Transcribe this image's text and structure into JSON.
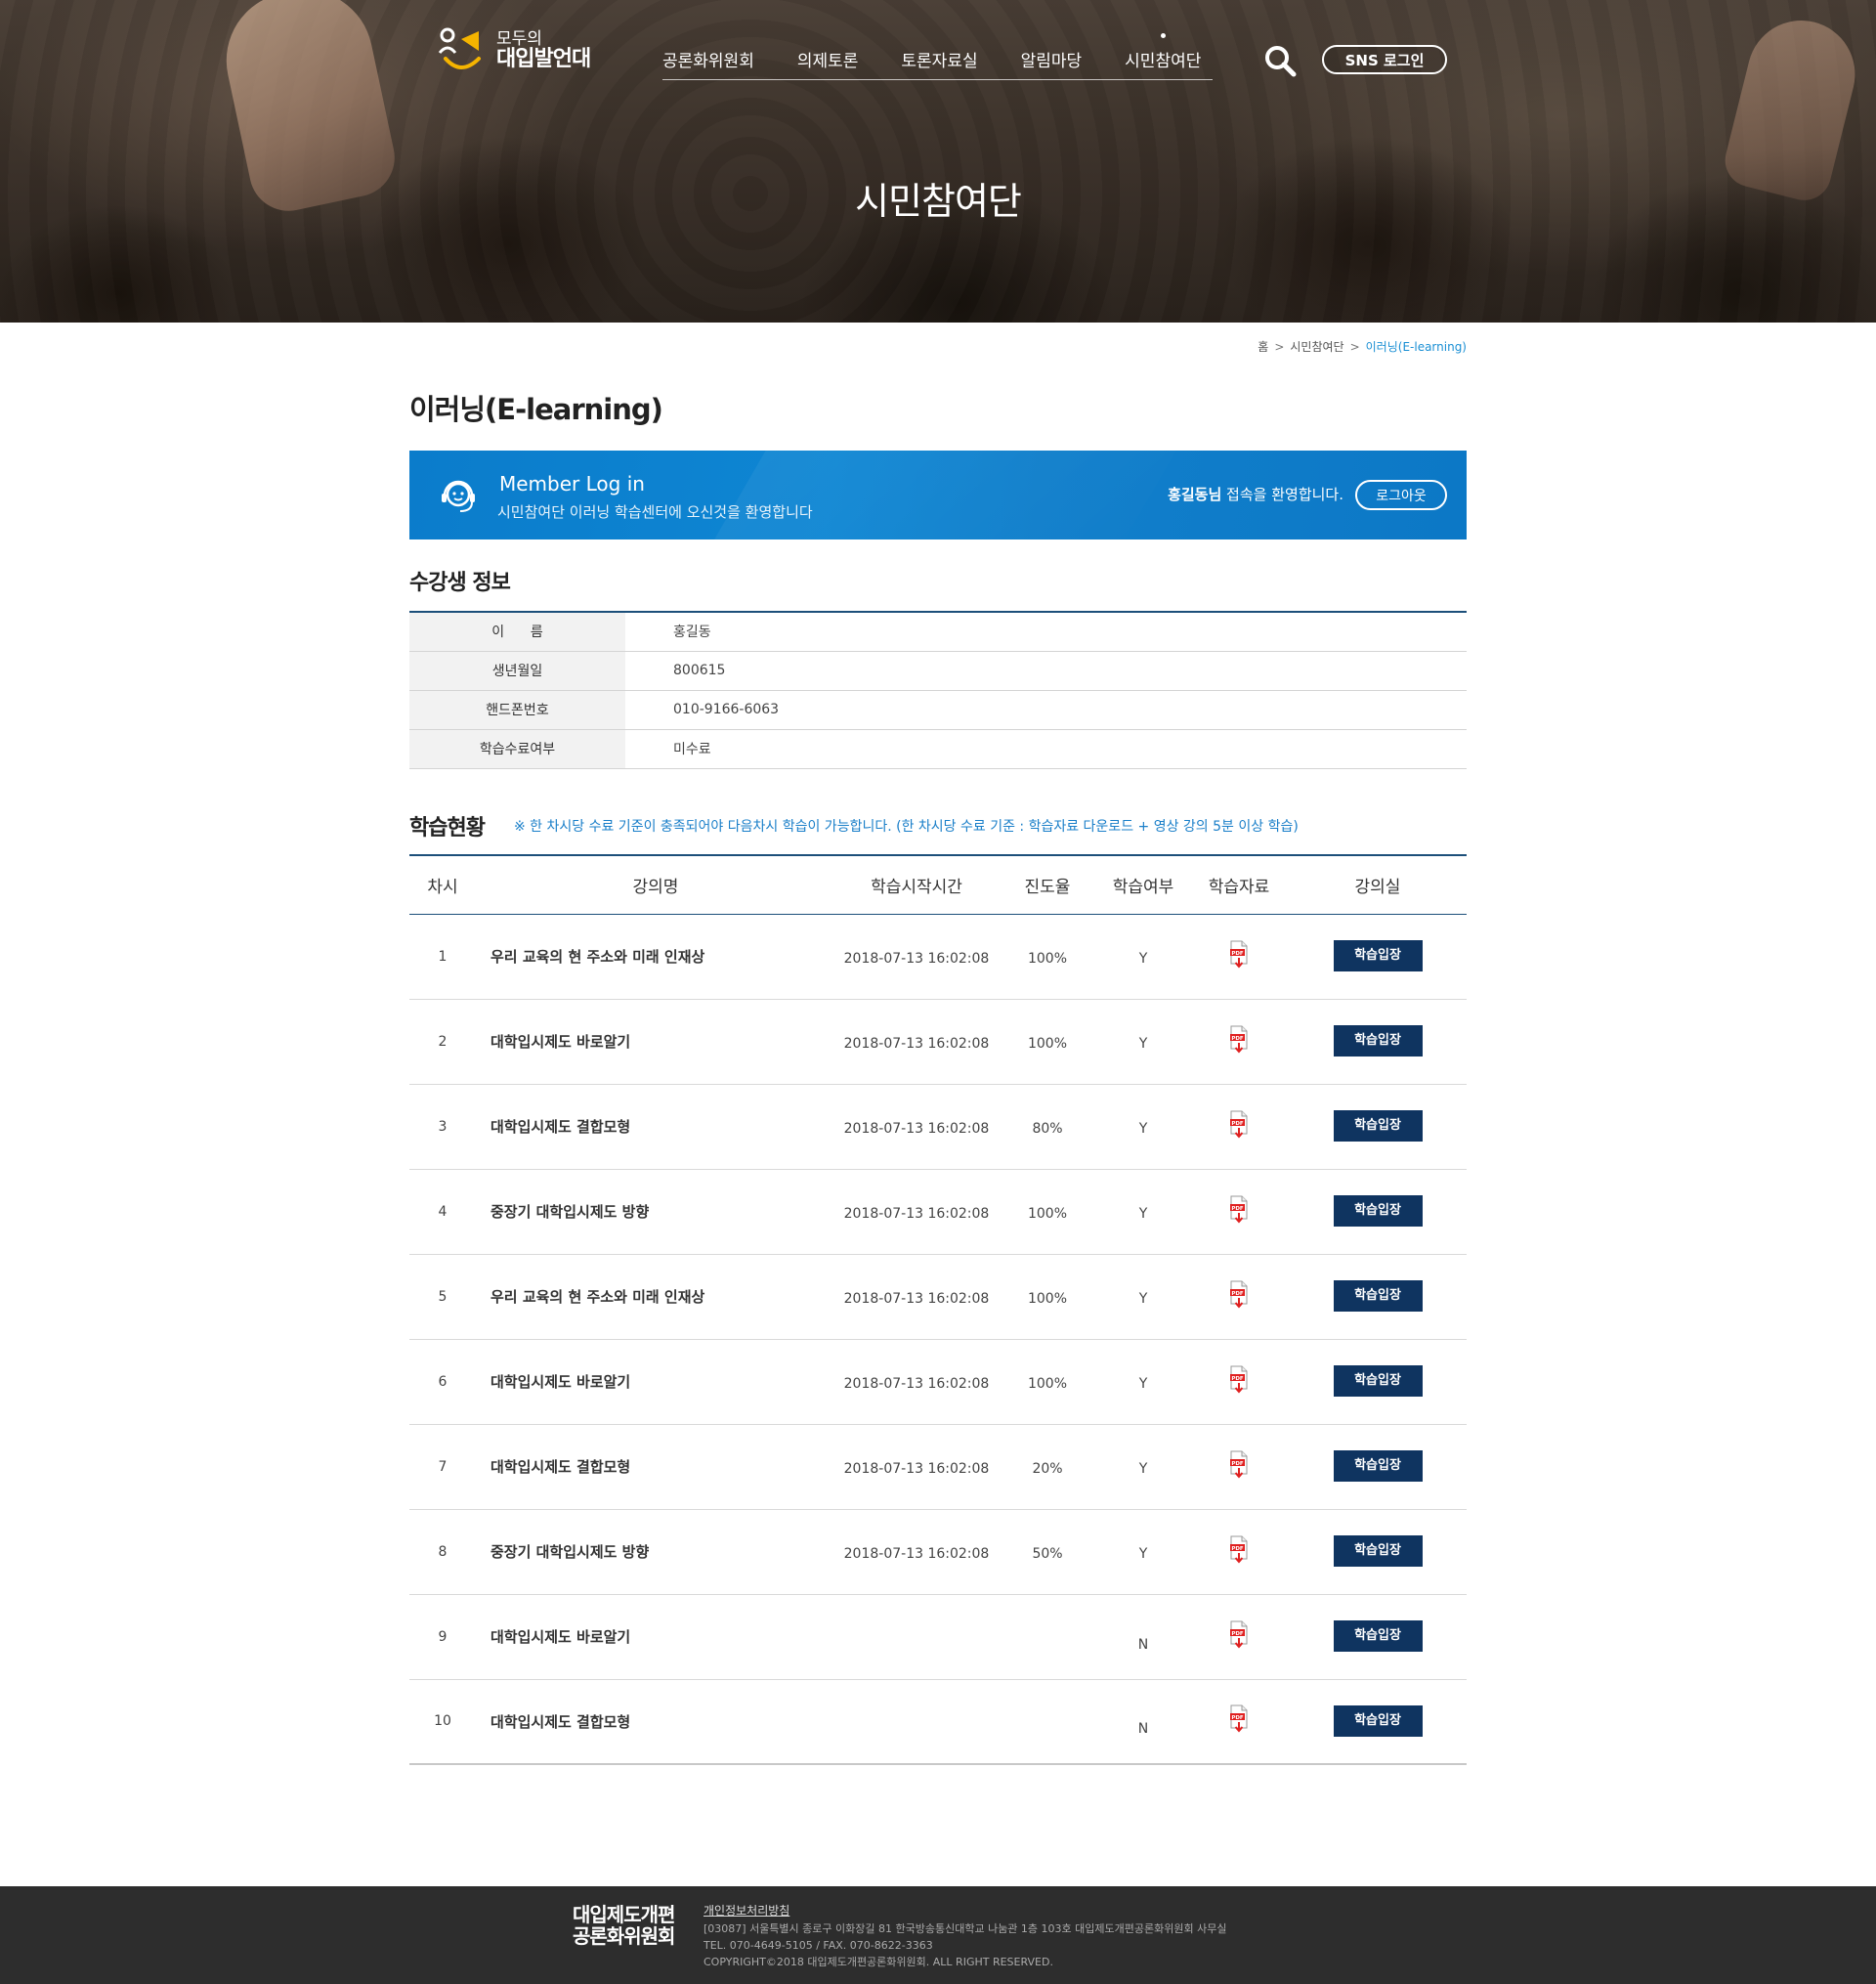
{
  "header": {
    "logo_small": "모두의",
    "logo_big": "대입발언대",
    "menu": [
      "공론화위원회",
      "의제토론",
      "토론자료실",
      "알림마당",
      "시민참여단"
    ],
    "active_menu_index": 4,
    "sns_login": "SNS 로그인",
    "hero_title": "시민참여단"
  },
  "breadcrumb": {
    "home": "홈",
    "section": "시민참여단",
    "current": "이러닝(E-learning)"
  },
  "page_title": "이러닝(E-learning)",
  "member": {
    "heading": "Member Log in",
    "subtitle": "시민참여단 이러닝 학습센터에 오신것을 환영합니다",
    "user_name": "홍길동님",
    "welcome_suffix": " 접속을 환영합니다.",
    "logout": "로그아웃"
  },
  "student_info": {
    "title": "수강생 정보",
    "rows": [
      {
        "label": "이      름",
        "value": "홍길동"
      },
      {
        "label": "생년월일",
        "value": "800615"
      },
      {
        "label": "핸드폰번호",
        "value": "010-9166-6063"
      },
      {
        "label": "학습수료여부",
        "value": "미수료"
      }
    ]
  },
  "study": {
    "title": "학습현황",
    "notice": "※ 한 차시당 수료 기준이 충족되어야 다음차시 학습이 가능합니다. (한 차시당 수료 기준 : 학습자료 다운로드 + 영상 강의 5분 이상 학습)",
    "columns": [
      "차시",
      "강의명",
      "학습시작시간",
      "진도율",
      "학습여부",
      "학습자료",
      "강의실"
    ],
    "enter_label": "학습입장",
    "rows": [
      {
        "no": "1",
        "lecture": "우리 교육의 현 주소와 미래 인재상",
        "start": "2018-07-13 16:02:08",
        "progress": "100%",
        "done": "Y"
      },
      {
        "no": "2",
        "lecture": "대학입시제도 바로알기",
        "start": "2018-07-13 16:02:08",
        "progress": "100%",
        "done": "Y"
      },
      {
        "no": "3",
        "lecture": "대학입시제도 결합모형",
        "start": "2018-07-13 16:02:08",
        "progress": "80%",
        "done": "Y"
      },
      {
        "no": "4",
        "lecture": "중장기 대학입시제도 방향",
        "start": "2018-07-13 16:02:08",
        "progress": "100%",
        "done": "Y"
      },
      {
        "no": "5",
        "lecture": "우리 교육의 현 주소와 미래 인재상",
        "start": "2018-07-13 16:02:08",
        "progress": "100%",
        "done": "Y"
      },
      {
        "no": "6",
        "lecture": "대학입시제도 바로알기",
        "start": "2018-07-13 16:02:08",
        "progress": "100%",
        "done": "Y"
      },
      {
        "no": "7",
        "lecture": "대학입시제도 결합모형",
        "start": "2018-07-13 16:02:08",
        "progress": "20%",
        "done": "Y"
      },
      {
        "no": "8",
        "lecture": "중장기 대학입시제도 방향",
        "start": "2018-07-13 16:02:08",
        "progress": "50%",
        "done": "Y"
      },
      {
        "no": "9",
        "lecture": "대학입시제도 바로알기",
        "start": "",
        "progress": "",
        "done": "N"
      },
      {
        "no": "10",
        "lecture": "대학입시제도 결합모형",
        "start": "",
        "progress": "",
        "done": "N"
      }
    ]
  },
  "footer": {
    "logo_line1": "대입제도개편",
    "logo_line2": "공론화위원회",
    "privacy": "개인정보처리방침",
    "address": "[03087] 서울특별시 종로구 이화장길 81 한국방송통신대학교 나눔관 1층 103호 대입제도개편공론화위원회 사무실",
    "contact": "TEL. 070-4649-5105 / FAX. 070-8622-3363",
    "copyright": "COPYRIGHT©2018 대입제도개편공론화위원회. ALL RIGHT RESERVED."
  },
  "colors": {
    "accent_blue": "#0e86d3",
    "navy": "#0f3460",
    "notice_blue": "#1a7fc9",
    "footer_bg": "#2d2d2d"
  }
}
